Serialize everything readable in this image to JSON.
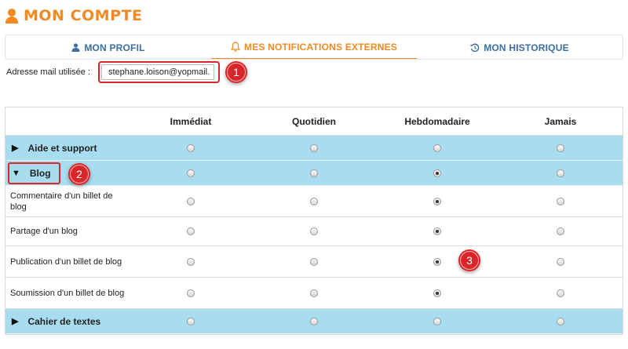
{
  "header": {
    "title": "MON COMPTE",
    "icon": "user-icon",
    "color": "#f08a24"
  },
  "tabs": [
    {
      "label": "MON PROFIL",
      "icon": "user-icon",
      "active": false
    },
    {
      "label": "MES NOTIFICATIONS EXTERNES",
      "icon": "bell-icon",
      "active": true
    },
    {
      "label": "MON HISTORIQUE",
      "icon": "history-icon",
      "active": false
    }
  ],
  "email": {
    "label": "Adresse mail utilisée :",
    "value": "stephane.loison@yopmail."
  },
  "columns": [
    "Immédiat",
    "Quotidien",
    "Hebdomadaire",
    "Jamais"
  ],
  "rows": [
    {
      "type": "category",
      "label": "Aide et support",
      "expanded": false,
      "selected": null
    },
    {
      "type": "category",
      "label": "Blog",
      "expanded": true,
      "selected": 2
    },
    {
      "type": "item",
      "label": "Commentaire d'un billet de blog",
      "selected": 2
    },
    {
      "type": "item",
      "label": "Partage d'un blog",
      "selected": 2
    },
    {
      "type": "item",
      "label": "Publication d'un billet de blog",
      "selected": 2
    },
    {
      "type": "item",
      "label": "Soumission d'un billet de blog",
      "selected": 2
    },
    {
      "type": "category",
      "label": "Cahier de textes",
      "expanded": false,
      "selected": null
    }
  ],
  "annotations": [
    "1",
    "2",
    "3"
  ],
  "colors": {
    "accent": "#f08a24",
    "tab_text": "#3a6fa0",
    "category_bg": "#a8dcef",
    "annotation": "#d9262a"
  }
}
